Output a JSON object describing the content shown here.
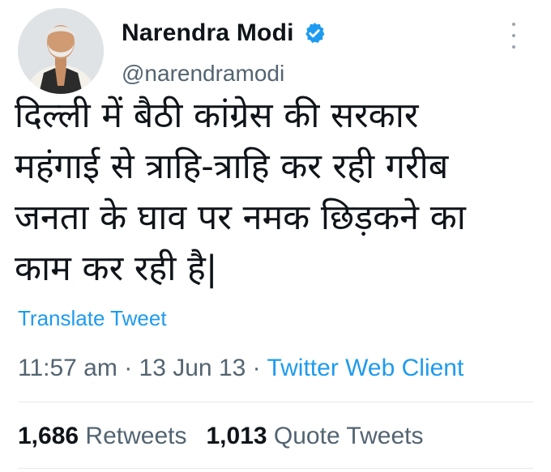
{
  "profile": {
    "display_name": "Narendra Modi",
    "handle": "@narendramodi",
    "verified_icon": "verified-badge-icon",
    "verified_color": "#1d9bf0"
  },
  "tweet": {
    "text": "दिल्ली में बैठी कांग्रेस की सरकार\nमहंगाई से त्राहि-त्राहि कर रही गरीब\nजनता के घाव पर नमक छिड़कने का\nकाम कर रही है|",
    "translate_label": "Translate Tweet",
    "time": "11:57 am",
    "date": "13 Jun 13",
    "separator": "·",
    "client": "Twitter Web Client"
  },
  "stats": {
    "retweets_count": "1,686",
    "retweets_label": "Retweets",
    "quotes_count": "1,013",
    "quotes_label": "Quote Tweets"
  },
  "colors": {
    "link": "#1d9bf0",
    "secondary_text": "#536471",
    "primary_text": "#0f1419"
  },
  "icons": {
    "more": "more-options-icon"
  }
}
